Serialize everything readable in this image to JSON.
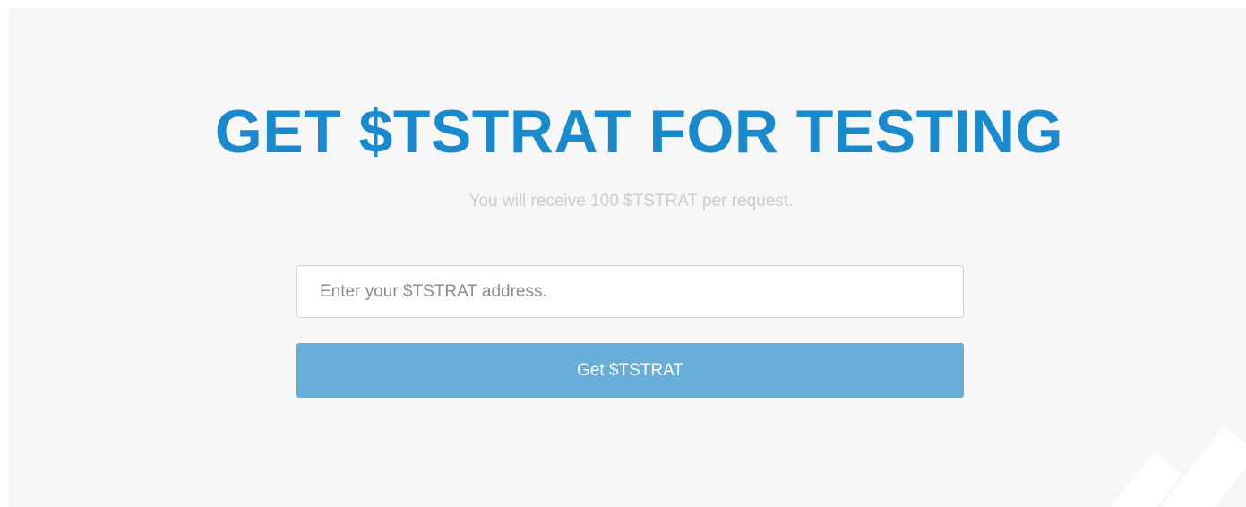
{
  "faucet": {
    "title": "GET $TSTRAT FOR TESTING",
    "subtitle": "You will receive 100 $TSTRAT per request.",
    "address_input": {
      "value": "",
      "placeholder": "Enter your $TSTRAT address."
    },
    "submit_label": "Get $TSTRAT"
  },
  "colors": {
    "title": "#1a8ace",
    "subtitle": "#c9ccd0",
    "button": "#67aed9",
    "panel_background": "#f7f7f8"
  }
}
